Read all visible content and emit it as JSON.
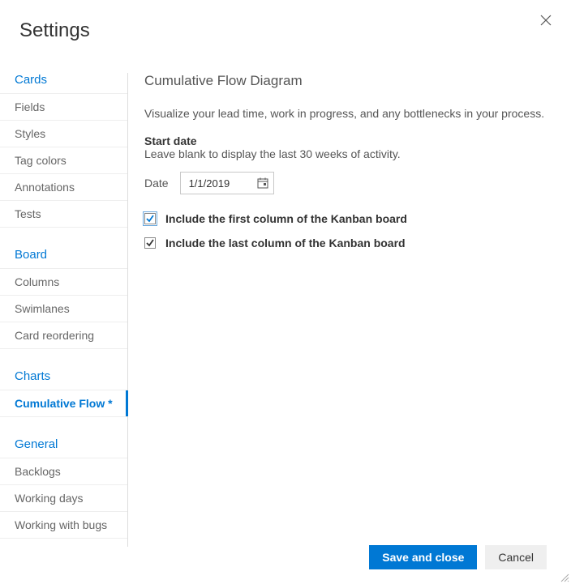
{
  "dialog": {
    "title": "Settings"
  },
  "sidebar": {
    "sections": {
      "cards": {
        "heading": "Cards",
        "items": [
          "Fields",
          "Styles",
          "Tag colors",
          "Annotations",
          "Tests"
        ]
      },
      "board": {
        "heading": "Board",
        "items": [
          "Columns",
          "Swimlanes",
          "Card reordering"
        ]
      },
      "charts": {
        "heading": "Charts",
        "items": [
          "Cumulative Flow *"
        ]
      },
      "general": {
        "heading": "General",
        "items": [
          "Backlogs",
          "Working days",
          "Working with bugs"
        ]
      }
    }
  },
  "content": {
    "title": "Cumulative Flow Diagram",
    "description": "Visualize your lead time, work in progress, and any bottlenecks in your process.",
    "startDate": {
      "label": "Start date",
      "help": "Leave blank to display the last 30 weeks of activity.",
      "fieldLabel": "Date",
      "value": "1/1/2019"
    },
    "options": {
      "includeFirst": {
        "label": "Include the first column of the Kanban board",
        "checked": true
      },
      "includeLast": {
        "label": "Include the last column of the Kanban board",
        "checked": true
      }
    }
  },
  "footer": {
    "primary": "Save and close",
    "secondary": "Cancel"
  }
}
